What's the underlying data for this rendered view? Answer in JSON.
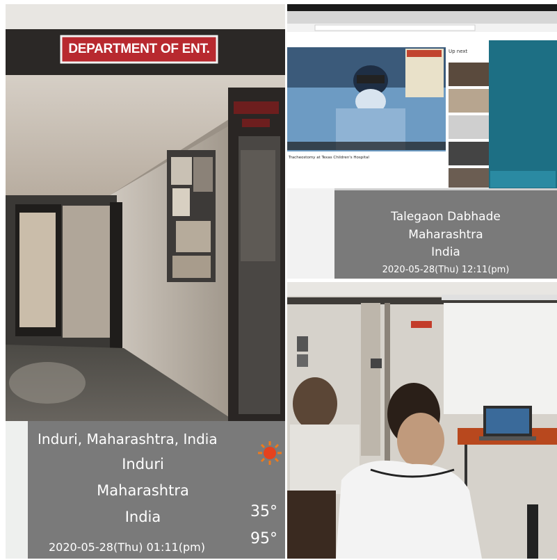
{
  "sign": {
    "text": "DEPARTMENT OF ENT."
  },
  "left_overlay": {
    "address": "Induri, Maharashtra, India",
    "city": "Induri",
    "state": "Maharashtra",
    "country": "India",
    "datetime": "2020-05-28(Thu)  01:11(pm)",
    "temp_c": "35°",
    "temp_f": "95°",
    "weather_icon": "sun-icon"
  },
  "tr_overlay": {
    "city": "Talegaon Dabhade",
    "state": "Maharashtra",
    "country": "India",
    "datetime": "2020-05-28(Thu)   12:11(pm)"
  },
  "browser": {
    "video_title": "Tracheostomy at Texas Children's Hospital",
    "up_next": "Up next"
  },
  "colors": {
    "sign_red": "#b8292f",
    "overlay_gray": "#7a7a7a",
    "sun": "#f07a1a"
  }
}
